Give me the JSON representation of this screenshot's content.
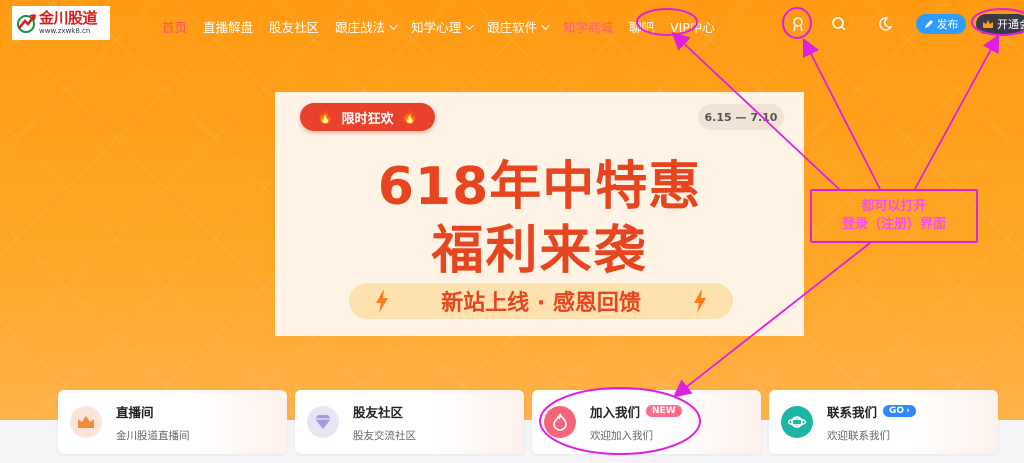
{
  "logo": {
    "name": "金川股道",
    "url": "www.zxwk8.cn"
  },
  "nav": {
    "items": [
      {
        "label": "首页",
        "type": "home"
      },
      {
        "label": "直播解盘"
      },
      {
        "label": "股友社区"
      },
      {
        "label": "跟庄战法",
        "dropdown": true
      },
      {
        "label": "知学心理",
        "dropdown": true
      },
      {
        "label": "跟庄软件",
        "dropdown": true
      },
      {
        "label": "知学商城",
        "type": "mall"
      },
      {
        "label": "聊吧"
      },
      {
        "label": "VIP中心"
      }
    ]
  },
  "header": {
    "icons": [
      "user-icon",
      "search-icon",
      "moon-icon"
    ],
    "publish_label": "发布",
    "vip_label": "开通会"
  },
  "banner": {
    "tag_left": "限时狂欢",
    "date_range": "6.15 — 7.10",
    "title_line1": "618年中特惠",
    "title_line2": "福利来袭",
    "slogan": "新站上线 · 感恩回馈"
  },
  "cards": [
    {
      "title": "直播间",
      "subtitle": "金川股道直播间",
      "icon": "crown-icon",
      "icon_bg": "#fde4da"
    },
    {
      "title": "股友社区",
      "subtitle": "股友交流社区",
      "icon": "diamond-icon",
      "icon_bg": "#e8e6f5"
    },
    {
      "title": "加入我们",
      "badge": "NEW",
      "subtitle": "欢迎加入我们",
      "icon": "flame-icon",
      "icon_bg": "#f5657a"
    },
    {
      "title": "联系我们",
      "badge": "GO",
      "subtitle": "欢迎联系我们",
      "icon": "planet-icon",
      "icon_bg": "#1fb5a6"
    }
  ],
  "annotation": {
    "line1": "都可以打开",
    "line2": "登录（注册）界面",
    "color": "#e020e0"
  }
}
